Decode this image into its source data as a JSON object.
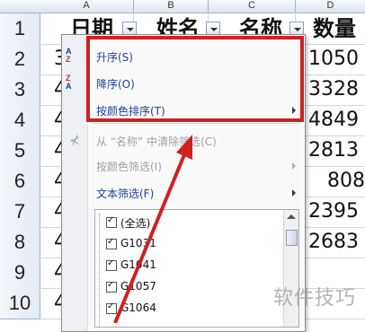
{
  "columns": [
    "A",
    "B",
    "C",
    "D"
  ],
  "rows": [
    "1",
    "2",
    "3",
    "4",
    "5",
    "6",
    "7",
    "8",
    "9",
    "10"
  ],
  "headers": {
    "date": "日期",
    "name": "姓名",
    "title": "名称",
    "qty": "数量"
  },
  "col_a_cells": [
    "3",
    "4",
    "4",
    "4",
    "4",
    "4",
    "4",
    "4",
    "4"
  ],
  "qty_cells": [
    "1050",
    "3328",
    "4849",
    "2813",
    "808",
    "2395",
    "2683",
    "",
    ""
  ],
  "menu": {
    "sort_asc": "升序(S)",
    "sort_desc": "降序(O)",
    "sort_by_color": "按颜色排序(T)",
    "clear_filter": "从 “名称” 中清除筛选(C)",
    "filter_by_color": "按颜色筛选(I)",
    "text_filter": "文本筛选(F)",
    "list": [
      "(全选)",
      "G1031",
      "G1041",
      "G1057",
      "G1064"
    ]
  },
  "icons": {
    "sort_asc": "sort-az-icon",
    "sort_desc": "sort-za-icon",
    "clear": "clear-filter-icon"
  },
  "watermark": "软件技巧",
  "colors": {
    "highlight": "#d02020",
    "menu_text": "#1f3f99",
    "disabled_text": "#a0a0a0"
  }
}
